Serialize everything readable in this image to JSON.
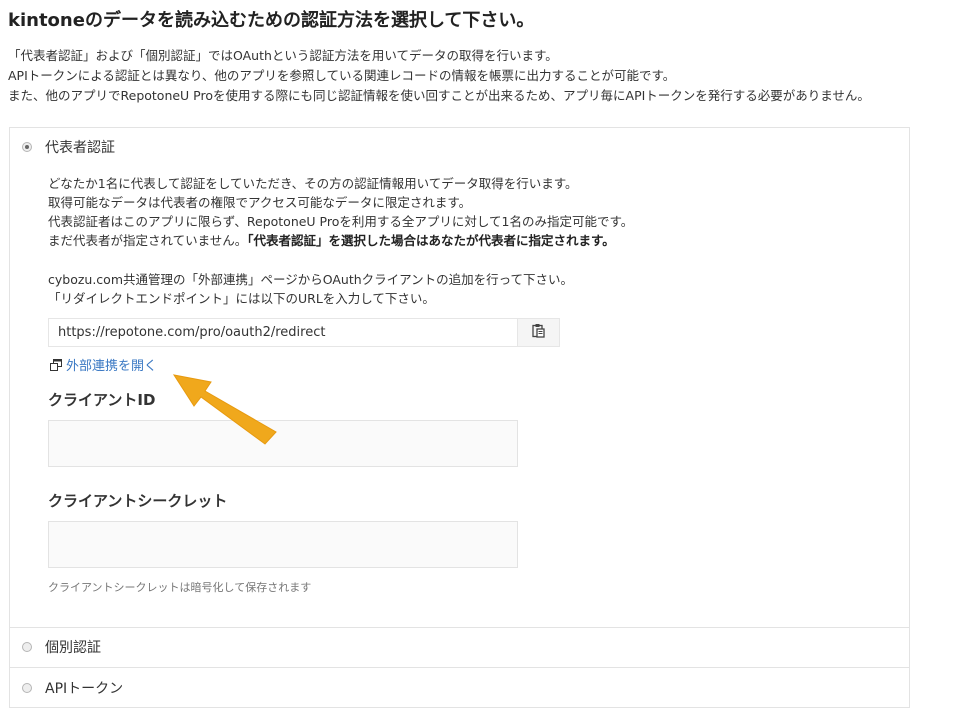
{
  "page_title": "kintoneのデータを読み込むための認証方法を選択して下さい。",
  "intro": [
    "「代表者認証」および「個別認証」ではOAuthという認証方法を用いてデータの取得を行います。",
    "APIトークンによる認証とは異なり、他のアプリを参照している関連レコードの情報を帳票に出力することが可能です。",
    "また、他のアプリでRepotoneU Proを使用する際にも同じ認証情報を使い回すことが出来るため、アプリ毎にAPIトークンを発行する必要がありません。"
  ],
  "options": {
    "representative": {
      "label": "代表者認証",
      "selected": true,
      "description": [
        "どなたか1名に代表して認証をしていただき、その方の認証情報用いてデータ取得を行います。",
        "取得可能なデータは代表者の権限でアクセス可能なデータに限定されます。",
        "代表認証者はこのアプリに限らず、RepotoneU Proを利用する全アプリに対して1名のみ指定可能です。"
      ],
      "status_prefix": "まだ代表者が指定されていません。",
      "status_bold": "「代表者認証」を選択した場合はあなたが代表者に指定されます。",
      "instructions": [
        "cybozu.com共通管理の「外部連携」ページからOAuthクライアントの追加を行って下さい。",
        "「リダイレクトエンドポイント」には以下のURLを入力して下さい。"
      ],
      "redirect_url": "https://repotone.com/pro/oauth2/redirect",
      "copy_icon": "clipboard-icon",
      "open_link_label": "外部連携を開く",
      "open_link_icon": "external-window-icon",
      "client_id_label": "クライアントID",
      "client_id_value": "",
      "client_secret_label": "クライアントシークレット",
      "client_secret_value": "",
      "client_secret_hint": "クライアントシークレットは暗号化して保存されます"
    },
    "individual": {
      "label": "個別認証",
      "selected": false
    },
    "api_token": {
      "label": "APIトークン",
      "selected": false
    }
  },
  "colors": {
    "link": "#3a78c3",
    "arrow": "#f0a81c",
    "border": "#e3e3e3"
  }
}
